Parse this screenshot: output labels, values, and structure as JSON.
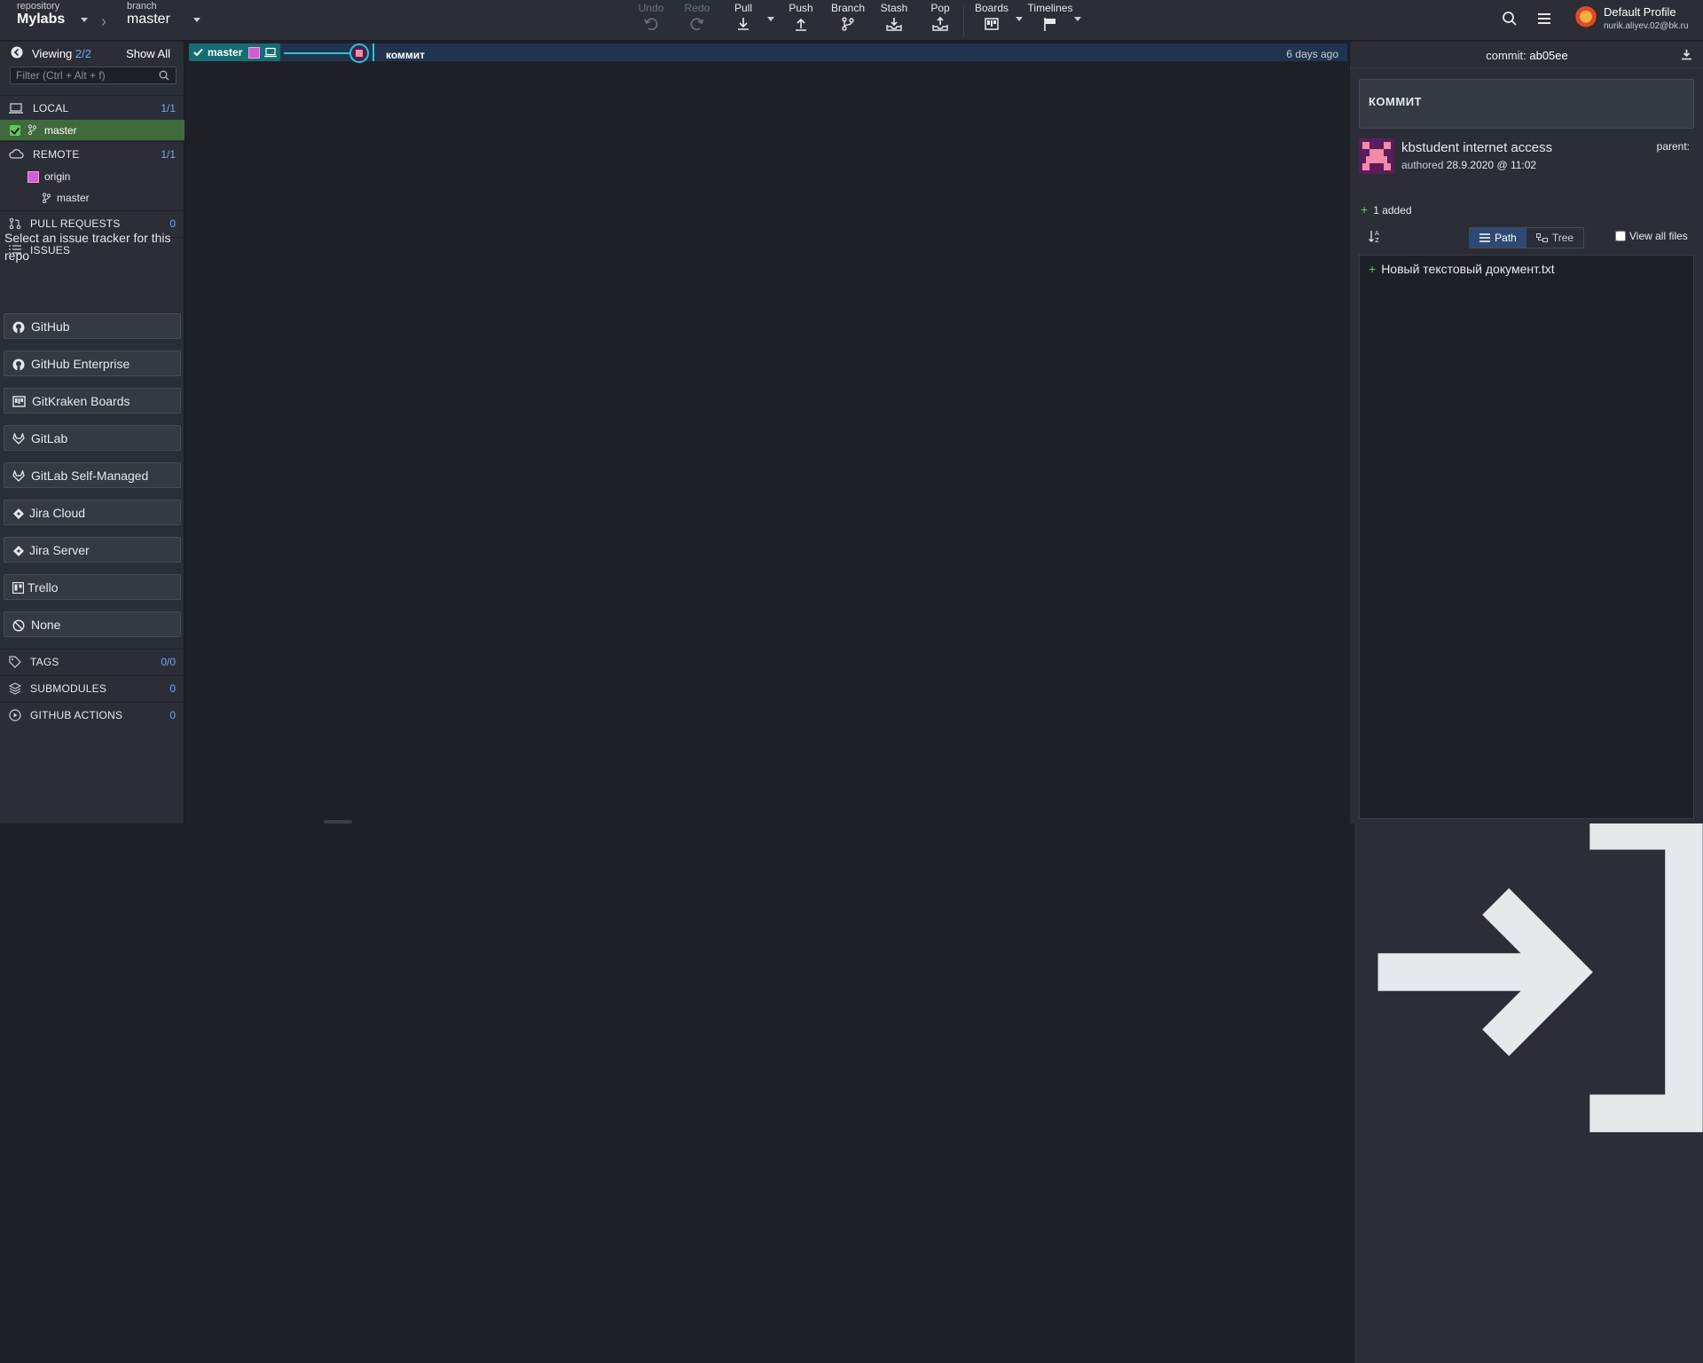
{
  "toolbar": {
    "repo_label": "repository",
    "repo_name": "Mylabs",
    "branch_label": "branch",
    "branch_name": "master",
    "buttons": [
      {
        "label": "Undo"
      },
      {
        "label": "Redo"
      },
      {
        "label": "Pull"
      },
      {
        "label": "Push"
      },
      {
        "label": "Branch"
      },
      {
        "label": "Stash"
      },
      {
        "label": "Pop"
      },
      {
        "label": "Boards"
      },
      {
        "label": "Timelines"
      }
    ],
    "profile_name": "Default Profile",
    "profile_email": "nurik.aliyev.02@bk.ru"
  },
  "sidebar": {
    "viewing_label": "Viewing",
    "viewing_count": "2/2",
    "show_all": "Show All",
    "filter_placeholder": "Filter (Ctrl + Alt + f)",
    "local": {
      "label": "LOCAL",
      "count": "1/1",
      "branch": "master"
    },
    "remote": {
      "label": "REMOTE",
      "count": "1/1",
      "origin": "origin",
      "branch": "master"
    },
    "pull_requests": {
      "label": "PULL REQUESTS",
      "count": "0"
    },
    "issues": {
      "label": "ISSUES",
      "prompt": "Select an issue tracker for this repo"
    },
    "trackers": [
      {
        "name": "GitHub"
      },
      {
        "name": "GitHub Enterprise"
      },
      {
        "name": "GitKraken Boards"
      },
      {
        "name": "GitLab"
      },
      {
        "name": "GitLab Self-Managed"
      },
      {
        "name": "Jira Cloud"
      },
      {
        "name": "Jira Server"
      },
      {
        "name": "Trello"
      },
      {
        "name": "None"
      }
    ],
    "tags": {
      "label": "TAGS",
      "count": "0/0"
    },
    "submodules": {
      "label": "SUBMODULES",
      "count": "0"
    },
    "github_actions": {
      "label": "GITHUB ACTIONS",
      "count": "0"
    }
  },
  "graph": {
    "branch_tag": "master",
    "commit_message": "коммит",
    "commit_time": "6 days ago"
  },
  "commit_panel": {
    "commit_label": "commit:",
    "sha": "ab05ee",
    "message": "КОММИТ",
    "author": "kbstudent internet access",
    "authored_label": "authored",
    "authored_date": "28.9.2020 @ 11:02",
    "parent_label": "parent:",
    "added_summary": "1 added",
    "view_path": "Path",
    "view_tree": "Tree",
    "view_all_files": "View all files",
    "files": [
      {
        "name": "Новый текстовый документ.txt",
        "status": "added"
      }
    ]
  },
  "colors": {
    "accent": "#74a7f7",
    "branch_tag": "#156d73",
    "graph_line": "#2bc2d8",
    "added": "#5ecb5b",
    "local_selected": "#3f6a3b"
  }
}
